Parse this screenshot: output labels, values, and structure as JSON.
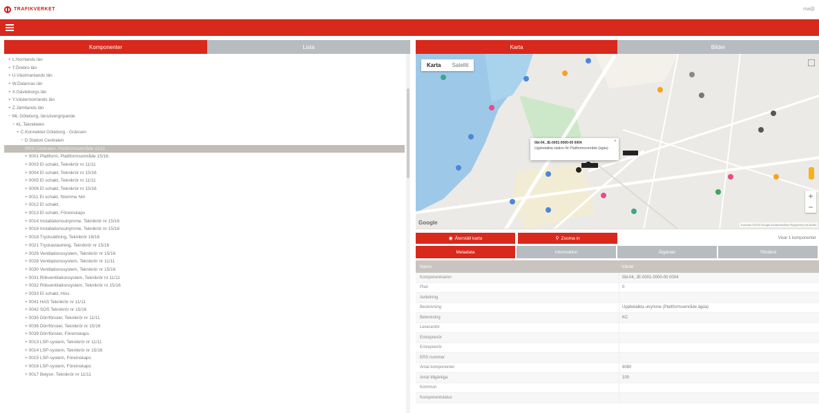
{
  "header": {
    "brand": "TRAFIKVERKET",
    "user": "ma@"
  },
  "left_tabs": [
    {
      "label": "Komponenter"
    },
    {
      "label": "Lista"
    }
  ],
  "right_tabs": [
    {
      "label": "Karta"
    },
    {
      "label": "Bilder"
    }
  ],
  "tree": [
    "+ L.Norrlands län",
    "+ T.Örebro län",
    "+ U.Västmanlands län",
    "+ W.Dalarnas län",
    "+ X.Gävleborgs län",
    "+ Y.Västernorrlands län",
    "+ Z.Jämtlands län",
    "− ML Göteborg, länsövergripande",
    "− KL.Tekniktekn",
    "+ C.Konnektet Göteborg - Gränsen",
    "− D.Station Centralen",
    "0000 Centralen, Plattformsområde 11/11",
    "+ 0001 Plattform, Plattformsområde 15/16",
    "+ 0003 El schakt, Teknikrör nr 11/11",
    "+ 0004 El schakt, Teknikrör nr 15/16",
    "+ 0005 El schakt, Teknikrör nr 11/11",
    "+ 0006 El schakt, Teknikrör nr 15/16",
    "+ 0011 El schakt, Stomme Nm",
    "+ 0012 El schakt,",
    "+ 0013 El schakt, Föreinskaps",
    "+ 0014 Installationsutrymme, Teknikrör nr 15/16",
    "+ 0016 Installationsutrymme, Teknikrör nr 15/16",
    "+ 0018 Trycksättning, Teknikrör 16/16",
    "+ 0021 Tryckavlastning, Teknikrör nr 15/16",
    "+ 0026 Ventilationssystem, Teknikrör nr 15/16",
    "+ 0028 Ventilationssystem, Teknikrör nr 11/11",
    "+ 0030 Ventilationssystem, Teknikrör nr 15/16",
    "+ 0031 Rökventilationsystem, Teknikrör nr 11/11",
    "+ 0032 Rökventilationsystem, Teknikrör nr 15/16",
    "+ 0033 El schakt, Hiss",
    "+ 0041 HAS Teknikrör nr 11/11",
    "+ 0042 SOS Teknikrör nr 15/16",
    "+ 0035 Dörrfönster, Teknikrör nr 11/11",
    "+ 0036 Dörrfönster, Teknikrör nr 15/16",
    "+ 0039 Dörrfönster, Föreinskaps",
    "+ 0013 LSP-system, Teknikrör nr 11/11",
    "+ 0014 LSP-system, Teknikrör nr 15/16",
    "+ 0015 LSP-system, Föreinskaps",
    "+ 0016 LSP-system, Föreinskaps",
    "+ 0017 Belysn. Teknikrör nr 11/11"
  ],
  "map": {
    "type_on": "Karta",
    "type_off": "Satellit",
    "popup_title": "0bl-04, JE-0001-0000-00 0004",
    "popup_text": "Uppbetalkta station för Plattformsområde (ägda)",
    "google": "Google",
    "attribution": "Kortdata ©2023 Google  Användarvillkor  Rapportera ett kartfel",
    "zoom_in": "+",
    "zoom_out": "−"
  },
  "actions": {
    "reset_label": "Återställ karta",
    "zoom_label": "Zooma in",
    "count_text": "Visar 1 komponenter"
  },
  "sub_tabs": [
    {
      "label": "Metadata"
    },
    {
      "label": "Information"
    },
    {
      "label": "Åtgärder"
    },
    {
      "label": "Tillstånd"
    }
  ],
  "props": {
    "header": {
      "name": "Namn",
      "value": "Värde"
    },
    "rows": [
      {
        "name": "Komponentnamn",
        "value": "0bl-04, JE-0001-0000-00 0004"
      },
      {
        "name": "Plan",
        "value": "0"
      },
      {
        "name": "Avdelning",
        "value": ""
      },
      {
        "name": "Beskrivning",
        "value": "Uppbetalkta utrymme (Plattformsområde ägda)"
      },
      {
        "name": "Beteckning",
        "value": "KC"
      },
      {
        "name": "Leverantör",
        "value": ""
      },
      {
        "name": "Entreprenör",
        "value": ""
      },
      {
        "name": "Entreprenör",
        "value": ""
      },
      {
        "name": "ERS nummer",
        "value": ""
      },
      {
        "name": "Antal komponenter",
        "value": "8080"
      },
      {
        "name": "Antal tillgänliga",
        "value": "100"
      },
      {
        "name": "Kommun",
        "value": ""
      },
      {
        "name": "Komponentstatus",
        "value": ""
      }
    ]
  }
}
